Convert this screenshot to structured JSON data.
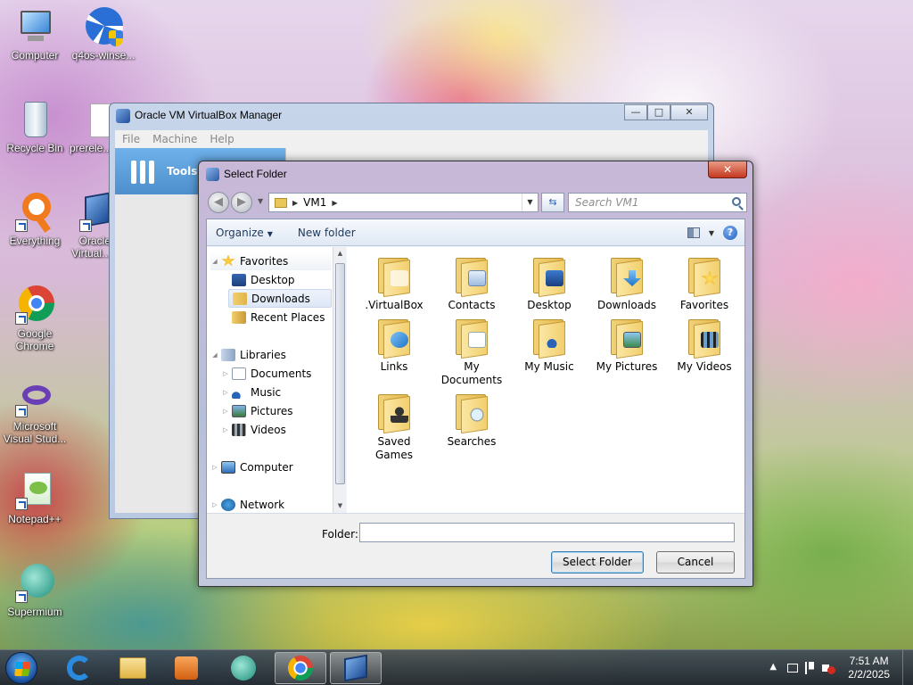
{
  "desktop": {
    "icons": [
      {
        "label": "Computer"
      },
      {
        "label": "q4os-winse..."
      },
      {
        "label": "Recycle Bin"
      },
      {
        "label": "prerele..."
      },
      {
        "label": "Everything"
      },
      {
        "label": "Oracle Virtual..."
      },
      {
        "label": "Google Chrome"
      },
      {
        "label": "Microsoft Visual Stud..."
      },
      {
        "label": "Notepad++"
      },
      {
        "label": "Supermium"
      }
    ]
  },
  "vbox_window": {
    "title": "Oracle VM VirtualBox Manager",
    "menu": [
      "File",
      "Machine",
      "Help"
    ],
    "tools_label": "Tools",
    "controls": {
      "minimize": "—",
      "maximize": "□",
      "close": "✕"
    }
  },
  "dialog": {
    "title": "Select Folder",
    "close": "✕",
    "address": {
      "path": "VM1"
    },
    "search_placeholder": "Search VM1",
    "toolbar": {
      "organize": "Organize",
      "new_folder": "New folder"
    },
    "nav": [
      {
        "label": "Favorites",
        "icon": "star-icon"
      },
      {
        "label": "Desktop",
        "icon": "desktop-icon"
      },
      {
        "label": "Downloads",
        "icon": "downloads-icon"
      },
      {
        "label": "Recent Places",
        "icon": "recent-places-icon"
      },
      {
        "label": "Libraries",
        "icon": "libraries-icon"
      },
      {
        "label": "Documents",
        "icon": "documents-icon"
      },
      {
        "label": "Music",
        "icon": "music-icon"
      },
      {
        "label": "Pictures",
        "icon": "pictures-icon"
      },
      {
        "label": "Videos",
        "icon": "videos-icon"
      },
      {
        "label": "Computer",
        "icon": "computer-icon"
      },
      {
        "label": "Network",
        "icon": "network-icon"
      }
    ],
    "folders": [
      {
        "line1": ".VirtualBox",
        "line2": ""
      },
      {
        "line1": "Contacts",
        "line2": ""
      },
      {
        "line1": "Desktop",
        "line2": ""
      },
      {
        "line1": "Downloads",
        "line2": ""
      },
      {
        "line1": "Favorites",
        "line2": ""
      },
      {
        "line1": "Links",
        "line2": ""
      },
      {
        "line1": "My",
        "line2": "Documents"
      },
      {
        "line1": "My Music",
        "line2": ""
      },
      {
        "line1": "My Pictures",
        "line2": ""
      },
      {
        "line1": "My Videos",
        "line2": ""
      },
      {
        "line1": "Saved",
        "line2": "Games"
      },
      {
        "line1": "Searches",
        "line2": ""
      }
    ],
    "folder_label": "Folder:",
    "folder_value": "",
    "select_button": "Select Folder",
    "cancel_button": "Cancel"
  },
  "taskbar": {
    "time": "7:51 AM",
    "date": "2/2/2025",
    "tray_up": "▲"
  },
  "colors": {
    "selection": "#dce7f6",
    "taskbar": "#1e2432",
    "link_text": "#1e395b"
  }
}
